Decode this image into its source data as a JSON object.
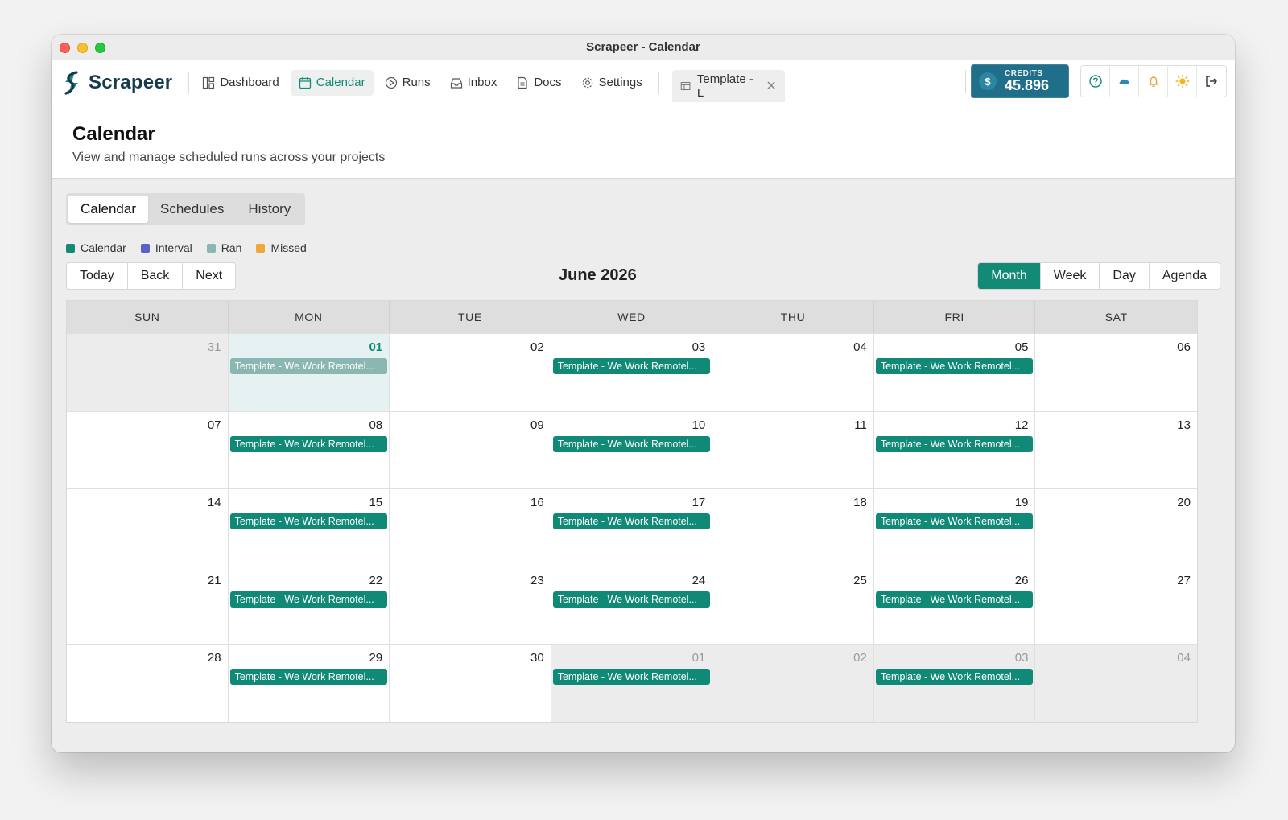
{
  "window": {
    "title": "Scrapeer - Calendar"
  },
  "brand": {
    "name": "Scrapeer"
  },
  "nav": {
    "items": [
      {
        "label": "Dashboard",
        "icon": "dashboard-icon"
      },
      {
        "label": "Calendar",
        "icon": "calendar-icon",
        "active": true
      },
      {
        "label": "Runs",
        "icon": "play-icon"
      },
      {
        "label": "Inbox",
        "icon": "inbox-icon"
      },
      {
        "label": "Docs",
        "icon": "document-icon"
      },
      {
        "label": "Settings",
        "icon": "gear-icon"
      }
    ],
    "open_tab": {
      "label": "Template - L",
      "icon": "template-icon"
    }
  },
  "credits": {
    "label": "CREDITS",
    "amount": "45.896",
    "symbol": "$"
  },
  "tools": [
    "help-icon",
    "cloud-icon",
    "bell-icon",
    "sun-icon",
    "logout-icon"
  ],
  "page": {
    "title": "Calendar",
    "subtitle": "View and manage scheduled runs across your projects"
  },
  "tabs": [
    {
      "label": "Calendar",
      "active": true
    },
    {
      "label": "Schedules"
    },
    {
      "label": "History"
    }
  ],
  "legend": [
    {
      "label": "Calendar",
      "color": "#138a76"
    },
    {
      "label": "Interval",
      "color": "#5b5fc7"
    },
    {
      "label": "Ran",
      "color": "#8ab7b1"
    },
    {
      "label": "Missed",
      "color": "#f2a53a"
    }
  ],
  "toolbar": {
    "nav_buttons": [
      "Today",
      "Back",
      "Next"
    ],
    "month_label": "June 2026",
    "views": [
      {
        "label": "Month",
        "active": true
      },
      {
        "label": "Week"
      },
      {
        "label": "Day"
      },
      {
        "label": "Agenda"
      }
    ]
  },
  "colors": {
    "accent": "#128a76",
    "ran": "#8ab7b1",
    "offmonth": "#ececec",
    "today": "#e6f1f1"
  },
  "calendar": {
    "weekdays": [
      "SUN",
      "MON",
      "TUE",
      "WED",
      "THU",
      "FRI",
      "SAT"
    ],
    "event_label": "Template - We Work Remotel...",
    "days": [
      {
        "n": "31",
        "off": true
      },
      {
        "n": "01",
        "today": true,
        "event": "ran"
      },
      {
        "n": "02"
      },
      {
        "n": "03",
        "event": "scheduled"
      },
      {
        "n": "04"
      },
      {
        "n": "05",
        "event": "scheduled"
      },
      {
        "n": "06"
      },
      {
        "n": "07"
      },
      {
        "n": "08",
        "event": "scheduled"
      },
      {
        "n": "09"
      },
      {
        "n": "10",
        "event": "scheduled"
      },
      {
        "n": "11"
      },
      {
        "n": "12",
        "event": "scheduled"
      },
      {
        "n": "13"
      },
      {
        "n": "14"
      },
      {
        "n": "15",
        "event": "scheduled"
      },
      {
        "n": "16"
      },
      {
        "n": "17",
        "event": "scheduled"
      },
      {
        "n": "18"
      },
      {
        "n": "19",
        "event": "scheduled"
      },
      {
        "n": "20"
      },
      {
        "n": "21"
      },
      {
        "n": "22",
        "event": "scheduled"
      },
      {
        "n": "23"
      },
      {
        "n": "24",
        "event": "scheduled"
      },
      {
        "n": "25"
      },
      {
        "n": "26",
        "event": "scheduled"
      },
      {
        "n": "27"
      },
      {
        "n": "28"
      },
      {
        "n": "29",
        "event": "scheduled"
      },
      {
        "n": "30"
      },
      {
        "n": "01",
        "off": true,
        "event": "scheduled"
      },
      {
        "n": "02",
        "off": true
      },
      {
        "n": "03",
        "off": true,
        "event": "scheduled"
      },
      {
        "n": "04",
        "off": true
      }
    ]
  }
}
